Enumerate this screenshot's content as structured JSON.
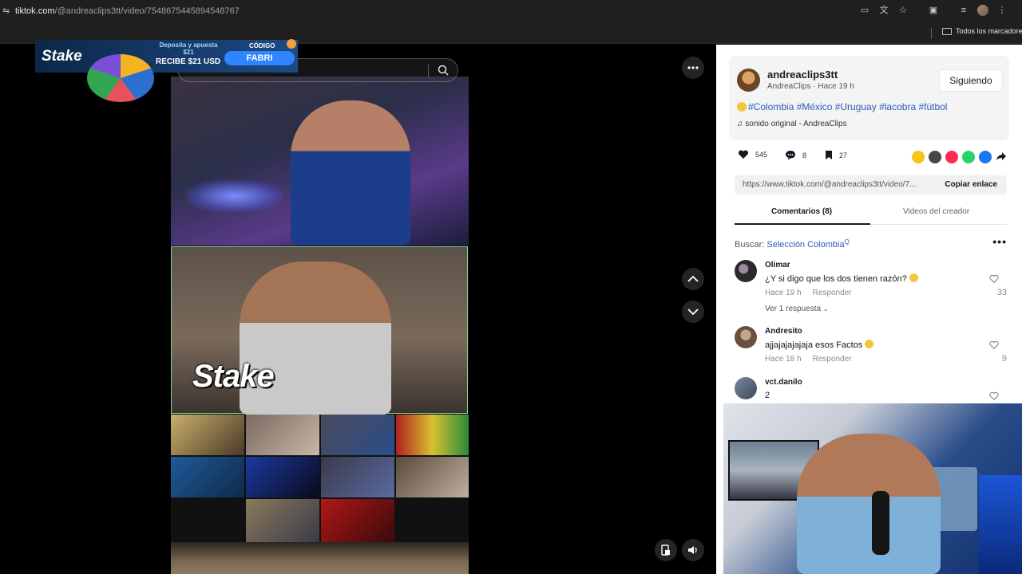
{
  "browser": {
    "url_host": "tiktok.com",
    "url_path": "/@andreaclips3tt/video/7548675445894548767",
    "bookmarks_folder": "Todos los marcadores"
  },
  "ad": {
    "logo": "Stake",
    "promo_line": "Deposita y apuesta $21",
    "recibe": "RECIBE $21 USD",
    "codigo_label": "CÓDIGO",
    "codigo_value": "FABRI"
  },
  "video": {
    "stake_watermark": "Stake"
  },
  "author": {
    "handle": "andreaclips3tt",
    "display_name": "AndreaClips",
    "posted": "Hace 19 h",
    "follow_label": "Siguiendo",
    "caption": "#Colombia #México #Uruguay #lacobra #fútbol",
    "sound": "sonido original - AndreaClips"
  },
  "stats": {
    "likes": "545",
    "comments": "8",
    "saves": "27"
  },
  "share": {
    "link": "https://www.tiktok.com/@andreaclips3tt/video/7...",
    "copy_label": "Copiar enlace"
  },
  "tabs": {
    "comments": "Comentarios (8)",
    "creator_videos": "Videos del creador"
  },
  "search": {
    "label": "Buscar:",
    "keyword": "Selección Colombia"
  },
  "comments": [
    {
      "user": "Olimar",
      "text": "¿Y si digo que los dos tienen razón?",
      "time": "Hace 19 h",
      "reply_label": "Responder",
      "likes": "33",
      "more_replies": "Ver 1 respuesta"
    },
    {
      "user": "Andresito",
      "text": "ajjajajajajaja esos Factos",
      "time": "Hace 18 h",
      "reply_label": "Responder",
      "likes": "9"
    },
    {
      "user": "vct.danilo",
      "text": "2"
    }
  ],
  "colors": {
    "accent_link": "#2b5db9",
    "tiktok_red": "#fe2c55"
  }
}
